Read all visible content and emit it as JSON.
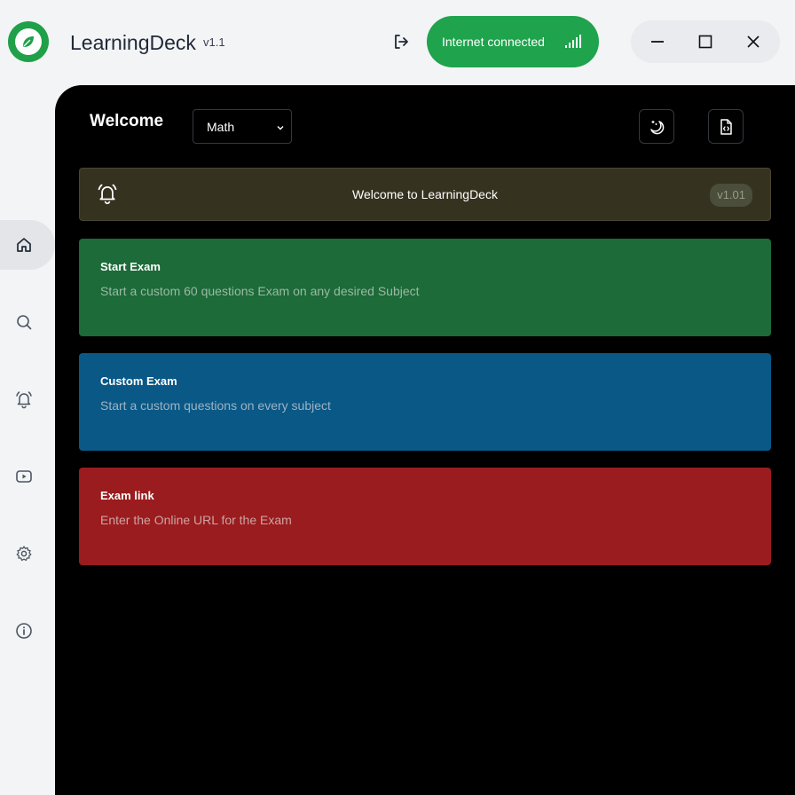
{
  "app": {
    "title": "LearningDeck",
    "version": "v1.1"
  },
  "network": {
    "status_label": "Internet connected"
  },
  "sidebar": {
    "items": [
      {
        "name": "home",
        "icon": "home-icon",
        "active": true
      },
      {
        "name": "search",
        "icon": "search-icon"
      },
      {
        "name": "alarm",
        "icon": "alarm-icon"
      },
      {
        "name": "video",
        "icon": "youtube-icon"
      },
      {
        "name": "settings",
        "icon": "gear-icon"
      },
      {
        "name": "info",
        "icon": "info-icon"
      }
    ]
  },
  "header": {
    "title": "Welcome",
    "subject_select": {
      "selected": "Math"
    }
  },
  "banner": {
    "text": "Welcome to LearningDeck",
    "badge": "v1.01"
  },
  "cards": [
    {
      "title": "Start Exam",
      "description": "Start a custom 60 questions Exam on any desired Subject",
      "color": "#1c6b38"
    },
    {
      "title": "Custom Exam",
      "description": "Start a custom questions on every subject",
      "color": "#0a5886"
    },
    {
      "title": "Exam link",
      "description": "Enter the Online URL for the Exam",
      "color": "#9a1c1e"
    }
  ],
  "colors": {
    "accent_green": "#1fa34c",
    "background": "#f3f4f6",
    "main_panel": "#000000"
  }
}
